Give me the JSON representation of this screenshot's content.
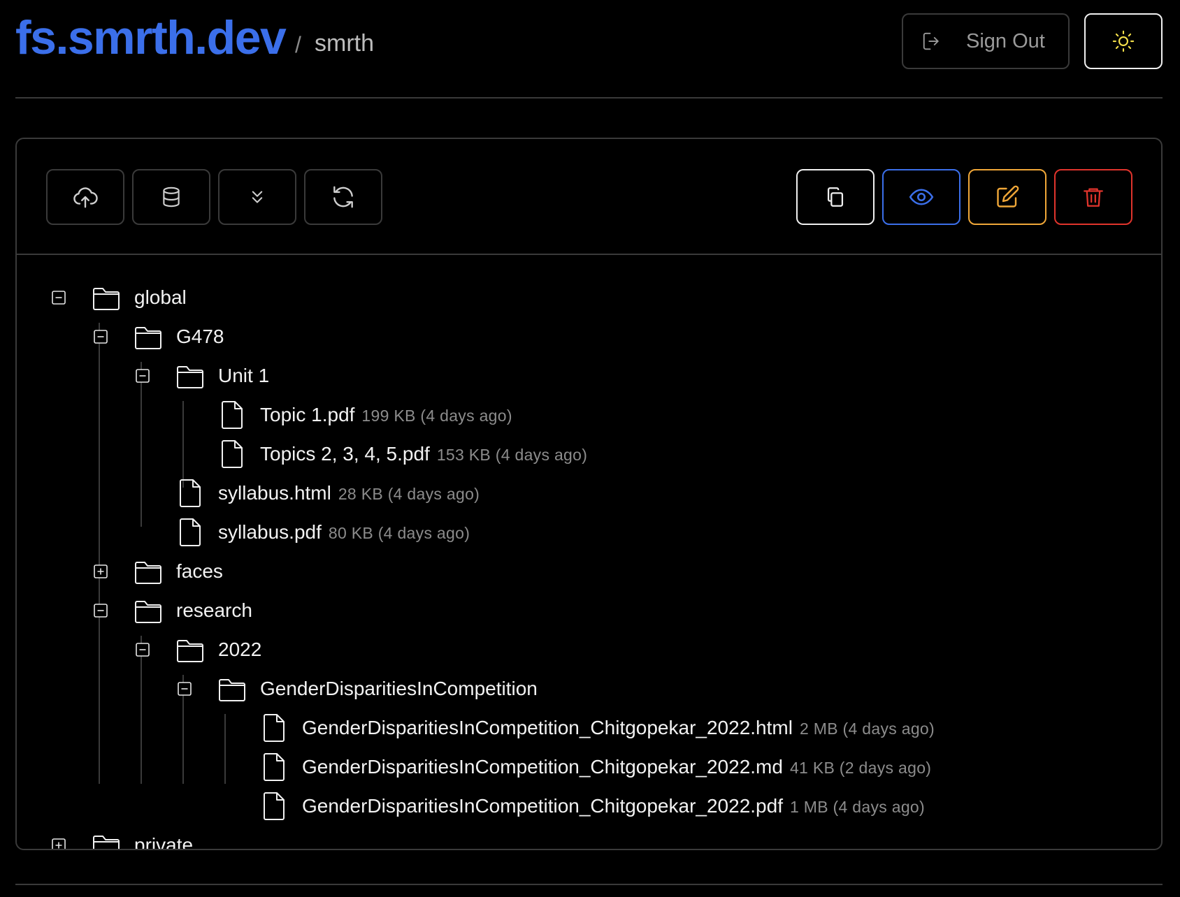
{
  "header": {
    "brand": "fs.smrth.dev",
    "separator": "/",
    "user": "smrth",
    "sign_out_label": "Sign Out",
    "theme_icon": "sun-icon",
    "colors": {
      "brand": "#3b6fea",
      "sun": "#f5e04a"
    }
  },
  "toolbar": {
    "left_buttons": [
      "upload-icon",
      "database-icon",
      "chevrons-down-icon",
      "refresh-icon"
    ],
    "right_buttons": [
      {
        "icon": "copy-icon",
        "color": "#f0f0f0"
      },
      {
        "icon": "eye-icon",
        "color": "#3b6fea"
      },
      {
        "icon": "edit-icon",
        "color": "#f0a738"
      },
      {
        "icon": "trash-icon",
        "color": "#e0342c"
      }
    ]
  },
  "tree": [
    {
      "name": "global",
      "type": "folder",
      "expanded": true
    },
    {
      "name": "G478",
      "type": "folder",
      "expanded": true
    },
    {
      "name": "Unit 1",
      "type": "folder",
      "expanded": true
    },
    {
      "name": "Topic 1.pdf",
      "type": "file",
      "meta": "199 KB (4 days ago)"
    },
    {
      "name": "Topics 2, 3, 4, 5.pdf",
      "type": "file",
      "meta": "153 KB (4 days ago)"
    },
    {
      "name": "syllabus.html",
      "type": "file",
      "meta": "28 KB (4 days ago)"
    },
    {
      "name": "syllabus.pdf",
      "type": "file",
      "meta": "80 KB (4 days ago)"
    },
    {
      "name": "faces",
      "type": "folder",
      "expanded": false
    },
    {
      "name": "research",
      "type": "folder",
      "expanded": true
    },
    {
      "name": "2022",
      "type": "folder",
      "expanded": true
    },
    {
      "name": "GenderDisparitiesInCompetition",
      "type": "folder",
      "expanded": true
    },
    {
      "name": "GenderDisparitiesInCompetition_Chitgopekar_2022.html",
      "type": "file",
      "meta": "2 MB (4 days ago)"
    },
    {
      "name": "GenderDisparitiesInCompetition_Chitgopekar_2022.md",
      "type": "file",
      "meta": "41 KB (2 days ago)"
    },
    {
      "name": "GenderDisparitiesInCompetition_Chitgopekar_2022.pdf",
      "type": "file",
      "meta": "1 MB (4 days ago)"
    },
    {
      "name": "private",
      "type": "folder",
      "expanded": false
    }
  ]
}
